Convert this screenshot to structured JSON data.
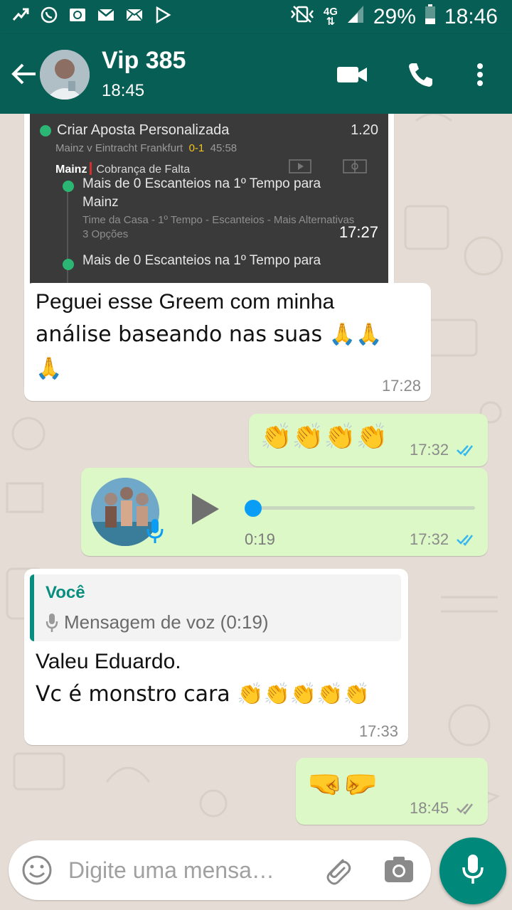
{
  "status_bar": {
    "network": "4G",
    "battery": "29%",
    "clock": "18:46"
  },
  "header": {
    "contact_name": "Vip 385",
    "subtitle": "18:45"
  },
  "messages": {
    "image": {
      "bet_title": "Criar Aposta Personalizada",
      "bet_odds": "1.20",
      "bet_match": "Mainz v Eintracht Frankfurt",
      "bet_score": "0-1",
      "bet_clock": "45:58",
      "team": "Mainz",
      "event": "Cobrança de Falta",
      "selection_1": "Mais de 0 Escanteios na 1º Tempo para",
      "selection_1_cont": "Mainz",
      "market_line": "Time da Casa - 1º Tempo - Escanteios - Mais Alternativas",
      "options": "3 Opções",
      "selection_2": "Mais de 0 Escanteios na 1º Tempo para",
      "time": "17:27"
    },
    "m1": {
      "line1": "Peguei esse Greem com minha",
      "line2": "análise baseando nas suas 🙏🙏",
      "line3": "🙏",
      "time": "17:28"
    },
    "m2": {
      "text": "👏👏👏👏",
      "time": "17:32"
    },
    "voice": {
      "duration": "0:19",
      "time": "17:32",
      "progress": 0
    },
    "m3": {
      "quote_author": "Você",
      "quote_text": "Mensagem de voz (0:19)",
      "line1": "Valeu Eduardo.",
      "line2": "Vc é monstro cara 👏👏👏👏👏",
      "time": "17:33"
    },
    "m4": {
      "text": "🤜🤛",
      "time": "18:45"
    }
  },
  "composer": {
    "placeholder": "Digite uma mensa…"
  },
  "colors": {
    "header": "#075e54",
    "outgoing": "#dcf8c6",
    "incoming": "#ffffff",
    "read_ticks": "#34b7f1",
    "accent": "#00897b"
  }
}
